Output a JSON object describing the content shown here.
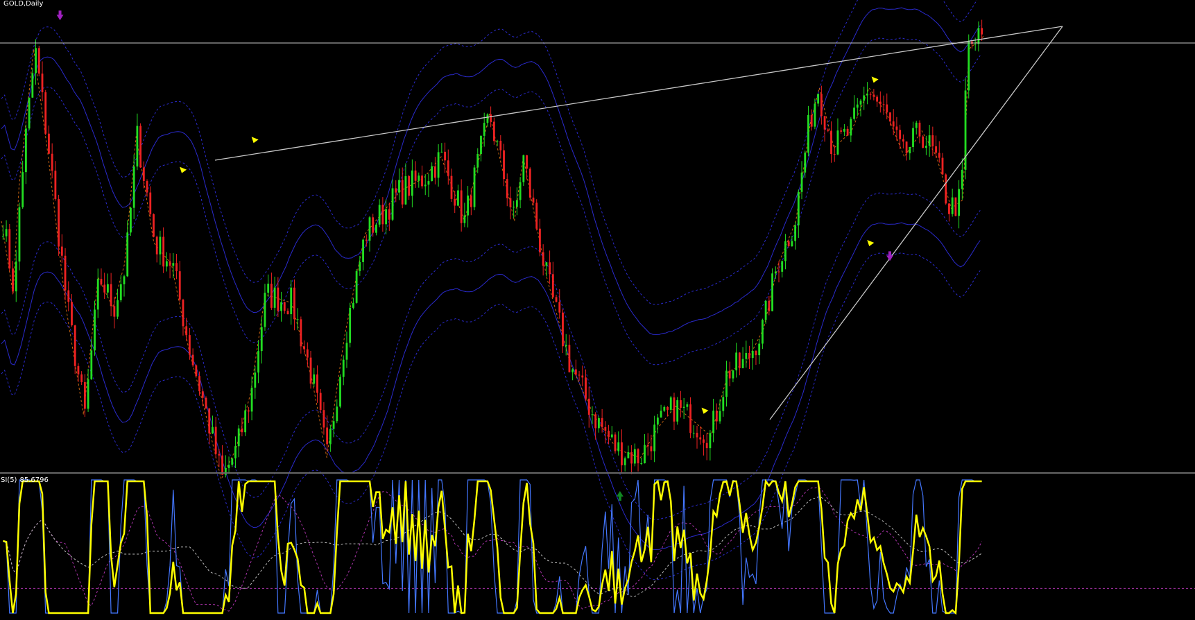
{
  "colors": {
    "background": "#000000",
    "bull": "#22dd22",
    "bear": "#ee2222",
    "band": "#2a2acc",
    "trendline": "#c8c8c8",
    "zigzag": "#cc6611",
    "arrow_down": "#a020c0",
    "arrow_up": "#118822",
    "marker": "#ffff00",
    "osc_main": "#ffff00",
    "osc_fast": "#4477ff",
    "osc_signal": "#aa33aa",
    "osc_avg": "#bbbbbb"
  },
  "chart_data": [
    {
      "type": "candlestick",
      "title": "GOLD,Daily",
      "symbol": "GOLD",
      "timeframe": "Daily",
      "bars": 300,
      "price_scale": "unlabeled",
      "anchors": [
        [
          0,
          0.55
        ],
        [
          8,
          0.38
        ],
        [
          12,
          0.63
        ],
        [
          22,
          0.95
        ],
        [
          32,
          0.7
        ],
        [
          44,
          0.35
        ],
        [
          56,
          0.1
        ],
        [
          66,
          0.42
        ],
        [
          76,
          0.35
        ],
        [
          84,
          0.45
        ],
        [
          92,
          0.75
        ],
        [
          104,
          0.5
        ],
        [
          116,
          0.45
        ],
        [
          128,
          0.25
        ],
        [
          138,
          0.12
        ],
        [
          150,
          -0.05
        ],
        [
          160,
          0.02
        ],
        [
          170,
          0.15
        ],
        [
          180,
          0.38
        ],
        [
          198,
          0.36
        ],
        [
          212,
          0.18
        ],
        [
          222,
          0.0
        ],
        [
          234,
          0.28
        ],
        [
          248,
          0.52
        ],
        [
          272,
          0.62
        ],
        [
          288,
          0.65
        ],
        [
          300,
          0.7
        ],
        [
          316,
          0.55
        ],
        [
          333,
          0.8
        ],
        [
          350,
          0.55
        ],
        [
          356,
          0.7
        ],
        [
          372,
          0.42
        ],
        [
          388,
          0.22
        ],
        [
          404,
          0.1
        ],
        [
          420,
          0.02
        ],
        [
          436,
          0.0
        ],
        [
          448,
          0.07
        ],
        [
          460,
          0.12
        ],
        [
          474,
          0.08
        ],
        [
          484,
          0.05
        ],
        [
          496,
          0.2
        ],
        [
          508,
          0.22
        ],
        [
          520,
          0.3
        ],
        [
          530,
          0.45
        ],
        [
          542,
          0.55
        ],
        [
          552,
          0.78
        ],
        [
          558,
          0.86
        ],
        [
          568,
          0.72
        ],
        [
          580,
          0.76
        ],
        [
          592,
          0.86
        ],
        [
          604,
          0.8
        ],
        [
          616,
          0.7
        ],
        [
          628,
          0.76
        ],
        [
          638,
          0.7
        ],
        [
          648,
          0.58
        ],
        [
          656,
          0.6
        ],
        [
          660,
          0.95
        ],
        [
          670,
          0.98
        ]
      ],
      "x_min": 0,
      "x_max": 670,
      "markers": {
        "down_arrows": [
          [
            40,
            1.04
          ],
          [
            1283,
            0.48
          ]
        ],
        "up_arrows": [
          [
            422,
            -0.1
          ]
        ],
        "triangles": [
          [
            124,
            0.67
          ],
          [
            173,
            0.74
          ],
          [
            480,
            0.11
          ],
          [
            596,
            0.88
          ],
          [
            593,
            0.5
          ]
        ]
      }
    },
    {
      "type": "line",
      "title": "SI(5) 85.6796",
      "indicator": "SI(5)",
      "last_value": "85.6796",
      "series": [
        {
          "role": "main",
          "color": "#ffff00"
        },
        {
          "role": "fast",
          "color": "#4477ff"
        },
        {
          "role": "signal",
          "color": "#aa33aa"
        },
        {
          "role": "average",
          "color": "#bbbbbb"
        }
      ],
      "levels": [
        20
      ]
    }
  ]
}
